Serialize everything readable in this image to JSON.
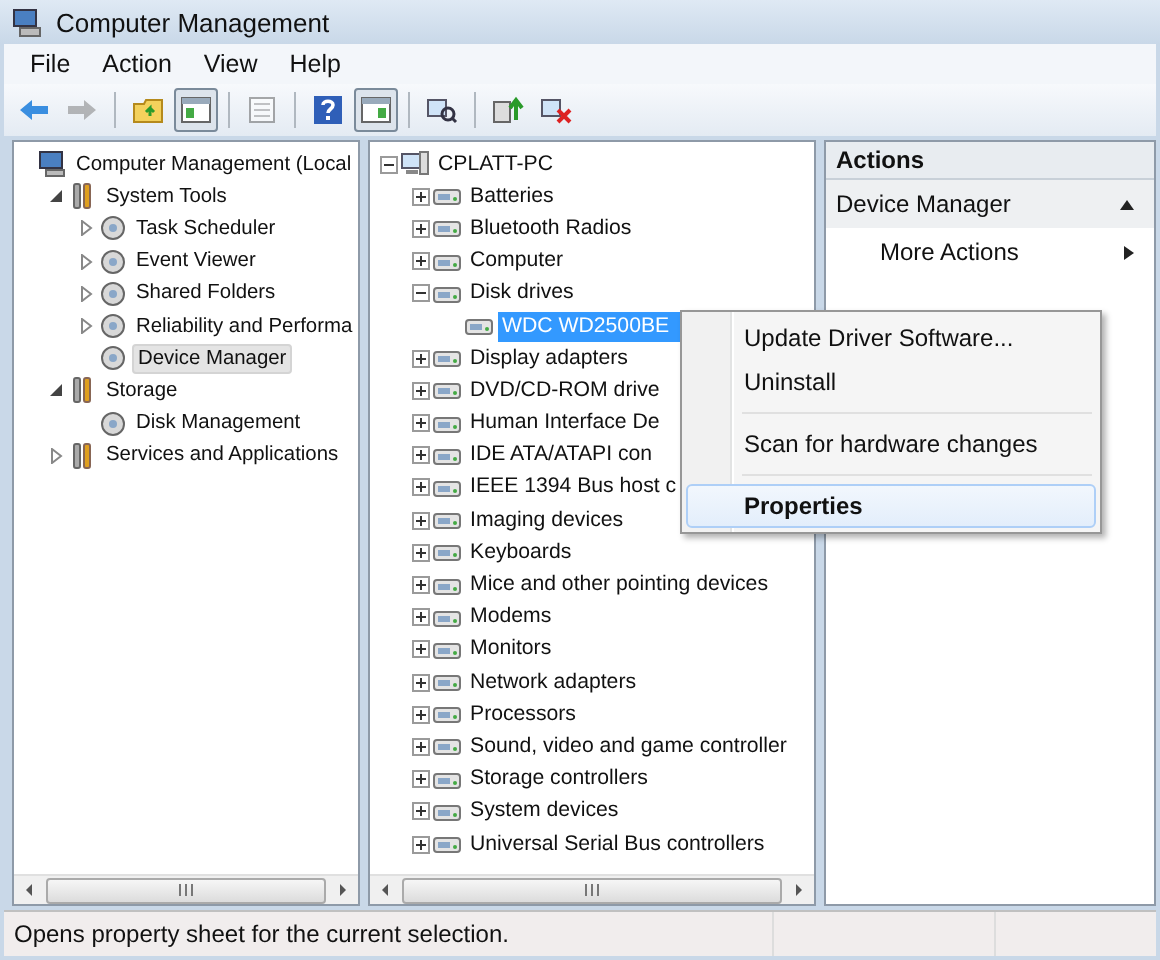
{
  "window": {
    "title": "Computer Management"
  },
  "menu_bar": [
    {
      "label": "File"
    },
    {
      "label": "Action"
    },
    {
      "label": "View"
    },
    {
      "label": "Help"
    }
  ],
  "toolbar": [
    {
      "kind": "back",
      "disabled": false,
      "pressed": false
    },
    {
      "kind": "forward",
      "disabled": true,
      "pressed": false
    },
    {
      "kind": "separator"
    },
    {
      "kind": "up",
      "disabled": false,
      "pressed": false
    },
    {
      "kind": "console-tree",
      "disabled": false,
      "pressed": true
    },
    {
      "kind": "separator"
    },
    {
      "kind": "properties",
      "disabled": true,
      "pressed": false
    },
    {
      "kind": "separator"
    },
    {
      "kind": "help",
      "disabled": false,
      "pressed": false
    },
    {
      "kind": "action-pane",
      "disabled": false,
      "pressed": true
    },
    {
      "kind": "separator"
    },
    {
      "kind": "scan",
      "disabled": false,
      "pressed": false
    },
    {
      "kind": "separator"
    },
    {
      "kind": "update",
      "disabled": false,
      "pressed": false
    },
    {
      "kind": "uninstall",
      "disabled": false,
      "pressed": false
    }
  ],
  "console_tree": [
    {
      "label": "Computer Management (Local",
      "selected": false,
      "children": [
        {
          "label": "System Tools",
          "expanded": true,
          "selected": false,
          "children": [
            {
              "label": "Task Scheduler",
              "expanded": false,
              "selected": false
            },
            {
              "label": "Event Viewer",
              "expanded": false,
              "selected": false
            },
            {
              "label": "Shared Folders",
              "expanded": false,
              "selected": false
            },
            {
              "label": "Reliability and Performa",
              "expanded": false,
              "selected": false
            },
            {
              "label": "Device Manager",
              "selected": true
            }
          ]
        },
        {
          "label": "Storage",
          "expanded": true,
          "selected": false,
          "children": [
            {
              "label": "Disk Management",
              "selected": false
            }
          ]
        },
        {
          "label": "Services and Applications",
          "expanded": false,
          "selected": false
        }
      ]
    }
  ],
  "device_tree": [
    {
      "label": "CPLATT-PC",
      "expanded": true,
      "selected": false,
      "children": [
        {
          "label": "Batteries",
          "expanded": false,
          "selected": false
        },
        {
          "label": "Bluetooth Radios",
          "expanded": false,
          "selected": false
        },
        {
          "label": "Computer",
          "expanded": false,
          "selected": false
        },
        {
          "label": "Disk drives",
          "expanded": true,
          "selected": false,
          "children": [
            {
              "label": "WDC WD2500BE",
              "selected": true
            }
          ]
        },
        {
          "label": "Display adapters",
          "expanded": false,
          "selected": false
        },
        {
          "label": "DVD/CD-ROM drive",
          "expanded": false,
          "selected": false
        },
        {
          "label": "Human Interface De",
          "expanded": false,
          "selected": false
        },
        {
          "label": "IDE ATA/ATAPI con",
          "expanded": false,
          "selected": false
        },
        {
          "label": "IEEE 1394 Bus host c",
          "expanded": false,
          "selected": false
        },
        {
          "label": "Imaging devices",
          "expanded": false,
          "selected": false
        },
        {
          "label": "Keyboards",
          "expanded": false,
          "selected": false
        },
        {
          "label": "Mice and other pointing devices",
          "expanded": false,
          "selected": false
        },
        {
          "label": "Modems",
          "expanded": false,
          "selected": false
        },
        {
          "label": "Monitors",
          "expanded": false,
          "selected": false
        },
        {
          "label": "Network adapters",
          "expanded": false,
          "selected": false
        },
        {
          "label": "Processors",
          "expanded": false,
          "selected": false
        },
        {
          "label": "Sound, video and game controller",
          "expanded": false,
          "selected": false
        },
        {
          "label": "Storage controllers",
          "expanded": false,
          "selected": false
        },
        {
          "label": "System devices",
          "expanded": false,
          "selected": false
        },
        {
          "label": "Universal Serial Bus controllers",
          "expanded": false,
          "selected": false
        }
      ]
    }
  ],
  "actions": {
    "title": "Actions",
    "items": [
      {
        "label": "Device Manager",
        "kind": "section"
      },
      {
        "label": "More Actions",
        "kind": "submenu"
      }
    ]
  },
  "context_menu": [
    {
      "kind": "item",
      "label": "Update Driver Software...",
      "default": false,
      "highlighted": false
    },
    {
      "kind": "item",
      "label": "Uninstall",
      "default": false,
      "highlighted": false
    },
    {
      "kind": "separator"
    },
    {
      "kind": "item",
      "label": "Scan for hardware changes",
      "default": false,
      "highlighted": false
    },
    {
      "kind": "separator"
    },
    {
      "kind": "item",
      "label": "Properties",
      "default": true,
      "highlighted": true
    }
  ],
  "status_bar": {
    "text": "Opens property sheet for the current selection."
  }
}
